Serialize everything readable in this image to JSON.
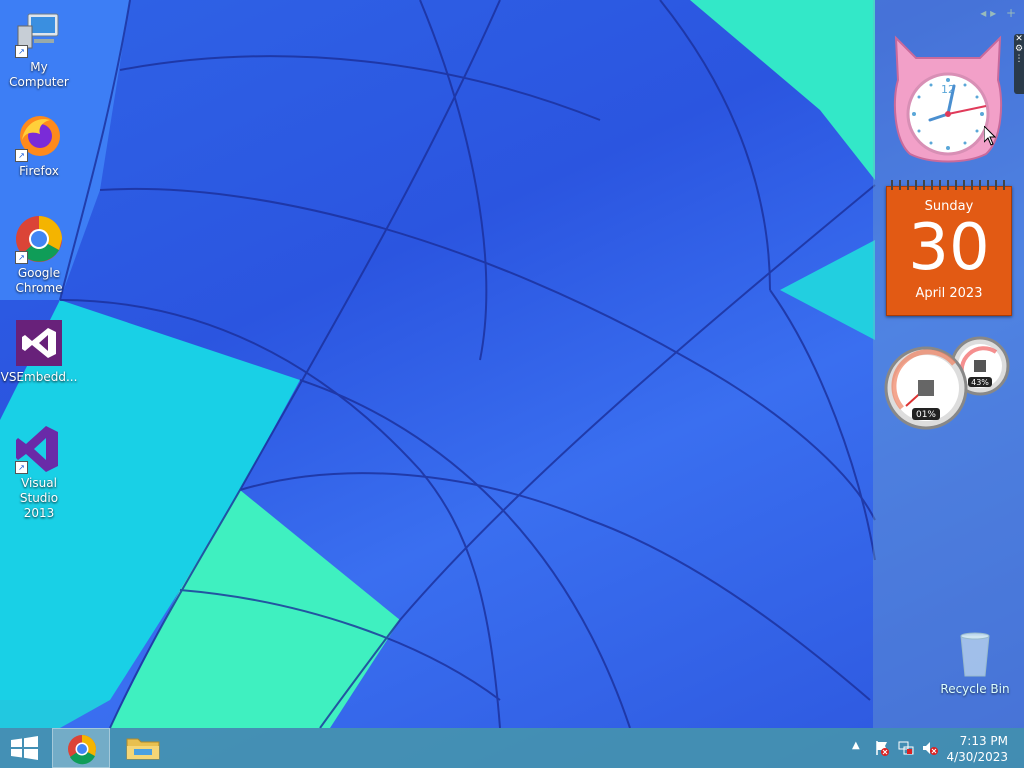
{
  "desktop": {
    "icons": [
      {
        "label": "My Computer"
      },
      {
        "label": "Firefox"
      },
      {
        "label": "Google Chrome"
      },
      {
        "label": "VSEmbedd..."
      },
      {
        "label": "Visual Studio 2013"
      }
    ],
    "recycle_bin": {
      "label": "Recycle Bin"
    }
  },
  "gadgets": {
    "clock": {
      "numeral_12": "12"
    },
    "calendar": {
      "weekday": "Sunday",
      "day": "30",
      "month_year": "April 2023"
    },
    "meter": {
      "cpu": "01%",
      "ram": "43%"
    }
  },
  "taskbar": {
    "clock_time": "7:13 PM",
    "clock_date": "4/30/2023"
  },
  "colors": {
    "calendar": "#e25a14",
    "taskbar": "#4696aa"
  }
}
